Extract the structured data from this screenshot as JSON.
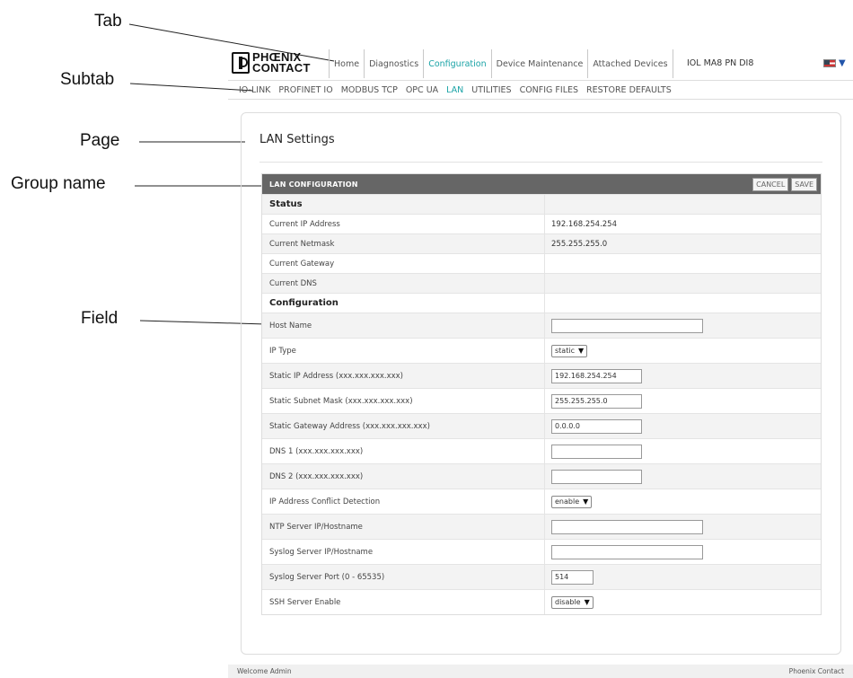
{
  "annotations": {
    "tab": "Tab",
    "subtab": "Subtab",
    "page": "Page",
    "group_name": "Group name",
    "field": "Field"
  },
  "logo": {
    "line1": "PHŒNIX",
    "line2": "CONTACT"
  },
  "tabs": [
    {
      "label": "Home",
      "active": false
    },
    {
      "label": "Diagnostics",
      "active": false
    },
    {
      "label": "Configuration",
      "active": true
    },
    {
      "label": "Device Maintenance",
      "active": false
    },
    {
      "label": "Attached Devices",
      "active": false
    }
  ],
  "device_name": "IOL MA8 PN DI8",
  "language_icon": "us-flag-icon",
  "subtabs": [
    {
      "label": "IO-LINK",
      "active": false
    },
    {
      "label": "PROFINET IO",
      "active": false
    },
    {
      "label": "MODBUS TCP",
      "active": false
    },
    {
      "label": "OPC UA",
      "active": false
    },
    {
      "label": "LAN",
      "active": true
    },
    {
      "label": "UTILITIES",
      "active": false
    },
    {
      "label": "CONFIG FILES",
      "active": false
    },
    {
      "label": "RESTORE DEFAULTS",
      "active": false
    }
  ],
  "page_title": "LAN Settings",
  "group": {
    "name": "LAN CONFIGURATION",
    "cancel_label": "CANCEL",
    "save_label": "SAVE"
  },
  "status": {
    "heading": "Status",
    "current_ip_label": "Current IP Address",
    "current_ip_value": "192.168.254.254",
    "current_netmask_label": "Current Netmask",
    "current_netmask_value": "255.255.255.0",
    "current_gateway_label": "Current Gateway",
    "current_gateway_value": "",
    "current_dns_label": "Current DNS",
    "current_dns_value": ""
  },
  "configuration": {
    "heading": "Configuration",
    "host_name_label": "Host Name",
    "host_name_value": "",
    "ip_type_label": "IP Type",
    "ip_type_value": "static",
    "static_ip_label": "Static IP Address (xxx.xxx.xxx.xxx)",
    "static_ip_value": "192.168.254.254",
    "static_subnet_label": "Static Subnet Mask (xxx.xxx.xxx.xxx)",
    "static_subnet_value": "255.255.255.0",
    "static_gateway_label": "Static Gateway Address (xxx.xxx.xxx.xxx)",
    "static_gateway_value": "0.0.0.0",
    "dns1_label": "DNS 1 (xxx.xxx.xxx.xxx)",
    "dns1_value": "",
    "dns2_label": "DNS 2 (xxx.xxx.xxx.xxx)",
    "dns2_value": "",
    "conflict_detection_label": "IP Address Conflict Detection",
    "conflict_detection_value": "enable",
    "ntp_label": "NTP Server IP/Hostname",
    "ntp_value": "",
    "syslog_label": "Syslog Server IP/Hostname",
    "syslog_value": "",
    "syslog_port_label": "Syslog Server Port (0 - 65535)",
    "syslog_port_value": "514",
    "ssh_label": "SSH Server Enable",
    "ssh_value": "disable"
  },
  "footer": {
    "left": "Welcome Admin",
    "right": "Phoenix Contact"
  }
}
